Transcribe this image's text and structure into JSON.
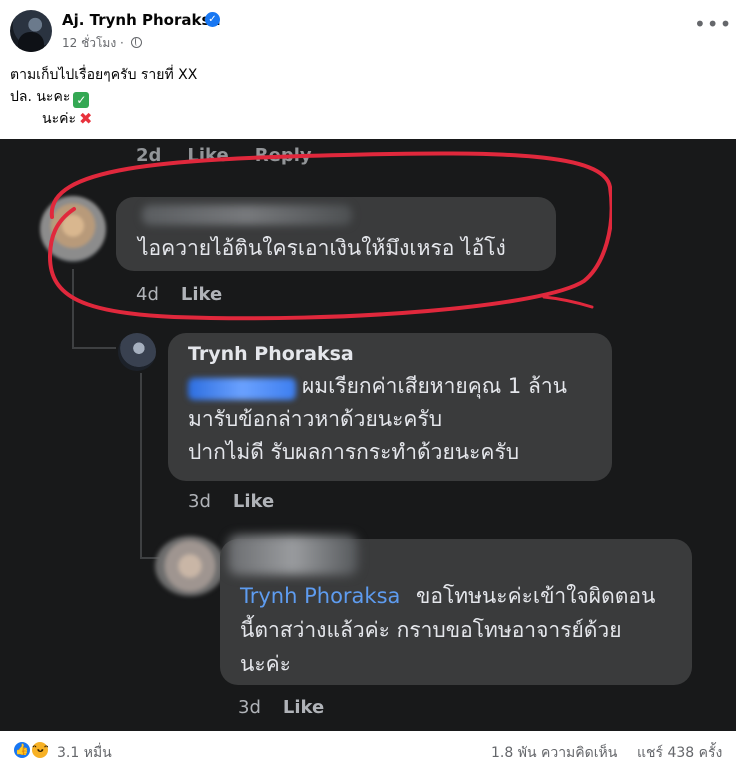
{
  "post": {
    "author": "Aj. Trynh Phoraksa",
    "time": "12 ชั่วโมง",
    "more_label": "•••",
    "caption_line1": "ตามเก็บไปเรื่อยๆครับ รายที่ XX",
    "caption_line2": "ปล. นะคะ",
    "caption_line3": "นะค่ะ"
  },
  "screenshot": {
    "faint_time": "2d",
    "faint_like": "Like",
    "faint_reply": "Reply",
    "comments": [
      {
        "text": "ไอควายไอ้ตินใครเอาเงินให้มึงเหรอ ไอ้โง่",
        "time": "4d",
        "like": "Like"
      },
      {
        "name": "Trynh Phoraksa",
        "line1": "ผมเรียกค่าเสียหายคุณ 1 ล้าน",
        "line2": "มารับข้อกล่าวหาด้วยนะครับ",
        "line3": "ปากไม่ดี รับผลการกระทำด้วยนะครับ",
        "time": "3d",
        "like": "Like"
      },
      {
        "mention": "Trynh Phoraksa",
        "line1": "ขอโทษนะค่ะเข้าใจผิดตอน",
        "line2": "นี้ตาสว่างแล้วค่ะ  กราบขอโทษอาจารย์ด้วย",
        "line3": "นะค่ะ",
        "time": "3d",
        "like": "Like"
      }
    ]
  },
  "footer": {
    "reactions": "3.1 หมื่น",
    "comments": "1.8 พัน ความคิดเห็น",
    "shares": "แชร์ 438 ครั้ง"
  },
  "icons": [
    "verified-icon",
    "globe-icon",
    "more-icon",
    "check-icon",
    "cross-icon",
    "react-like-icon",
    "react-haha-icon"
  ],
  "colors": {
    "highlight": "#e0283c",
    "mention": "#5e9cf0",
    "fb_blue": "#1877f2",
    "dark_bg": "#18191a",
    "bubble": "#3a3b3c"
  }
}
